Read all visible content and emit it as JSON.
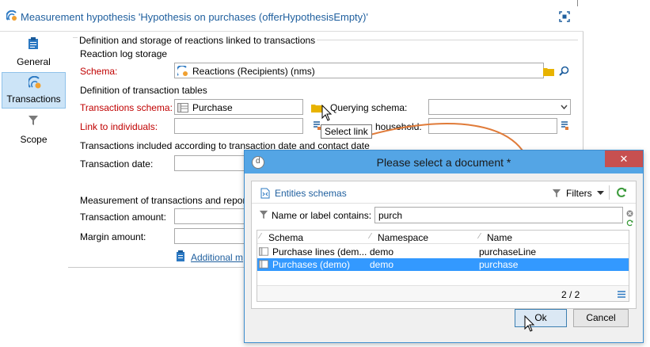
{
  "window": {
    "title": "Measurement hypothesis 'Hypothesis on purchases (offerHypothesisEmpty)'"
  },
  "sidebar": {
    "items": [
      {
        "label": "General"
      },
      {
        "label": "Transactions"
      },
      {
        "label": "Scope"
      }
    ]
  },
  "form": {
    "section_title": "Definition and storage of reactions linked to transactions",
    "reaction_log_storage": "Reaction log storage",
    "schema_label": "Schema:",
    "schema_value": "Reactions (Recipients) (nms)",
    "definition_tables": "Definition of transaction tables",
    "transactions_schema_label": "Transactions schema:",
    "transactions_schema_value": "Purchase",
    "querying_schema_label": "Querying schema:",
    "link_individuals_label": "Link to individuals:",
    "household_label": "household:",
    "included_by_date": "Transactions included according to transaction date and contact date",
    "transaction_date_label": "Transaction date:",
    "measurement_label": "Measurement of transactions and repor",
    "transaction_amount_label": "Transaction amount:",
    "margin_amount_label": "Margin amount:",
    "additional_link": "Additional m"
  },
  "tooltip": "Select link",
  "dialog": {
    "title": "Please select a document *",
    "close": "✕",
    "entities_label": "Entities schemas",
    "filters_label": "Filters",
    "search_label": "Name or label contains:",
    "search_value": "purch",
    "columns": [
      "Schema",
      "Namespace",
      "Name"
    ],
    "rows": [
      {
        "schema": "Purchase lines (dem...",
        "namespace": "demo",
        "name": "purchaseLine",
        "selected": false
      },
      {
        "schema": "Purchases (demo)",
        "namespace": "demo",
        "name": "purchase",
        "selected": true
      }
    ],
    "count": "2 / 2",
    "ok": "Ok",
    "cancel": "Cancel"
  },
  "colors": {
    "accent": "#1f5f9e",
    "required": "#c00000",
    "dialog_titlebar": "#54a5e5",
    "selection": "#3399ff",
    "arrow": "#e07b39"
  }
}
